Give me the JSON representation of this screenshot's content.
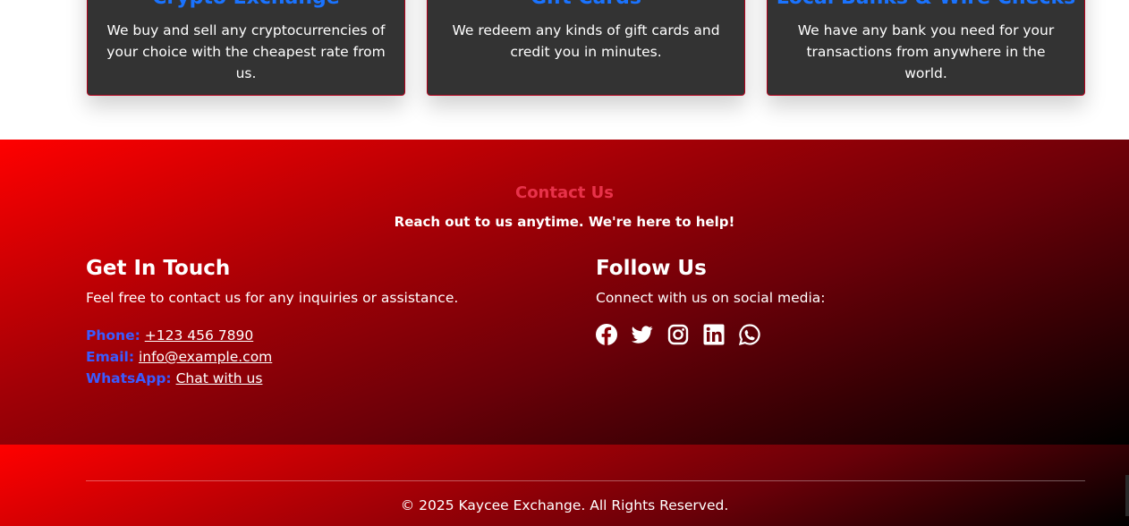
{
  "services": [
    {
      "title": "Crypto Exchange",
      "text": "We buy and sell any cryptocurrencies of your choice with the cheapest rate from us."
    },
    {
      "title": "Gift Cards",
      "text": "We redeem any kinds of gift cards and credit you in minutes."
    },
    {
      "title": "Local Banks & Wire Checks",
      "text": "We have any bank you need for your transactions from anywhere in the world."
    }
  ],
  "contact": {
    "title": "Contact Us",
    "subtitle": "Reach out to us anytime. We're here to help!",
    "get_in_touch": {
      "heading": "Get In Touch",
      "text": "Feel free to contact us for any inquiries or assistance.",
      "phone_label": "Phone:",
      "phone_value": "+123 456 7890",
      "email_label": "Email:",
      "email_value": "info@example.com",
      "whatsapp_label": "WhatsApp:",
      "whatsapp_value": "Chat with us"
    },
    "follow_us": {
      "heading": "Follow Us",
      "text": "Connect with us on social media:",
      "icons": [
        "facebook-icon",
        "twitter-icon",
        "instagram-icon",
        "linkedin-icon",
        "whatsapp-icon"
      ]
    }
  },
  "footer": {
    "copyright": "© 2025 Kaycee Exchange. All Rights Reserved."
  },
  "colors": {
    "accent_blue": "#1a73ff",
    "label_blue": "#3a5bff",
    "contact_title": "#e8324a",
    "brand_red": "#ff0000",
    "card_bg": "#333333"
  }
}
